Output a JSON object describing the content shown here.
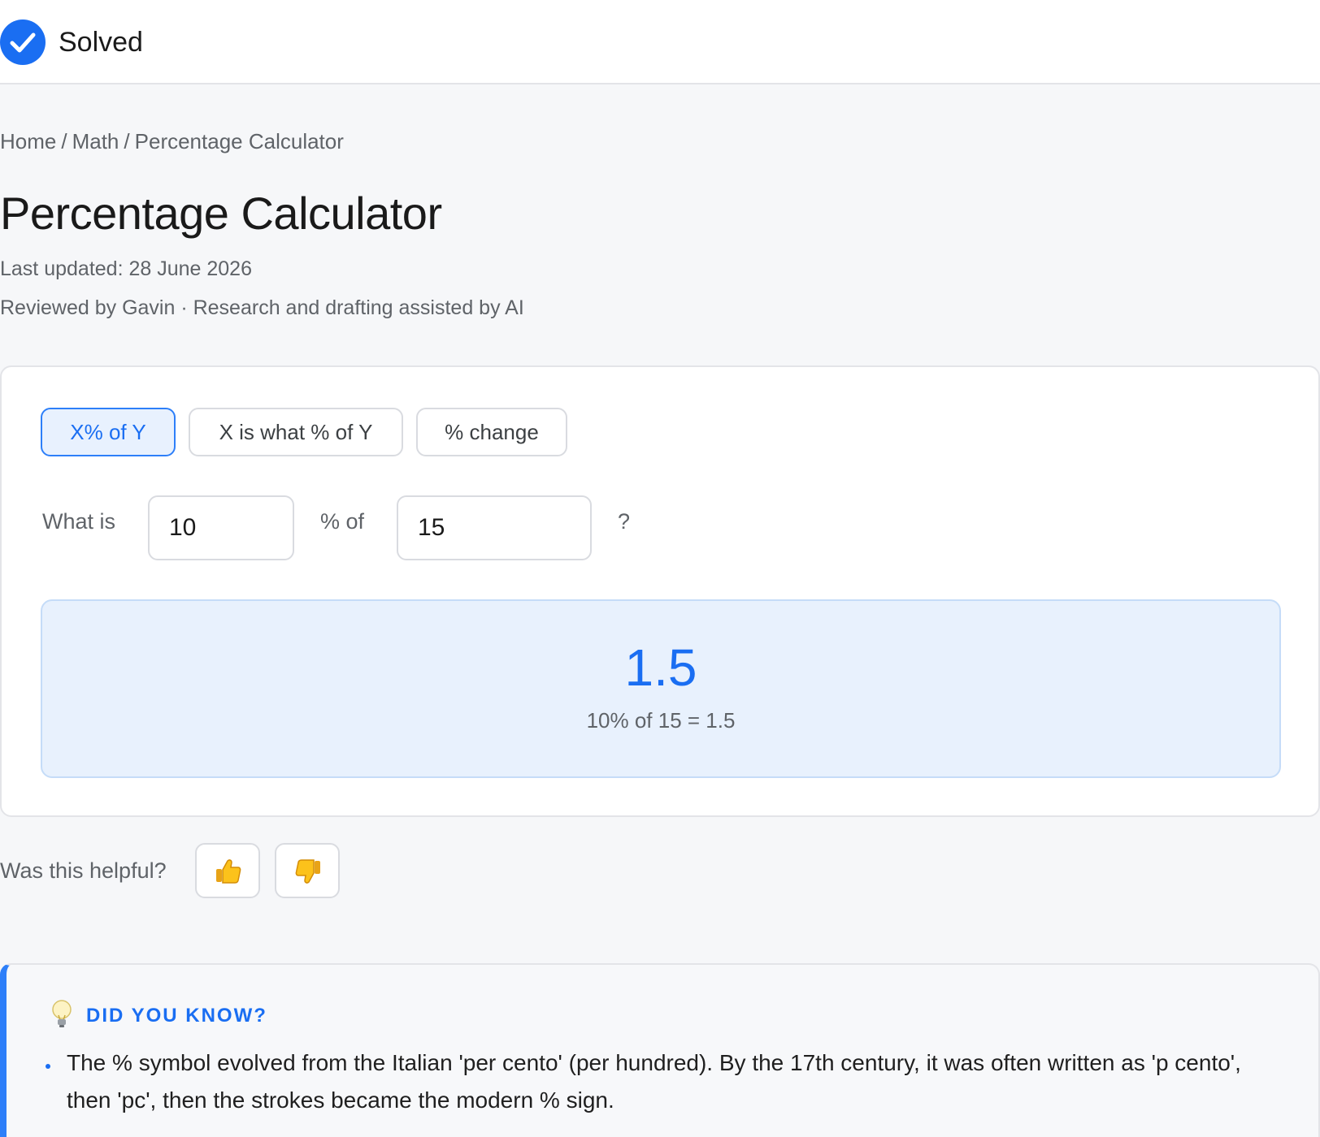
{
  "header": {
    "status_label": "Solved",
    "status_icon": "check-circle-icon",
    "accent_color": "#1a6ef2"
  },
  "breadcrumb": {
    "items": [
      "Home",
      "Math",
      "Percentage Calculator"
    ],
    "separator": "/"
  },
  "page": {
    "title": "Percentage Calculator",
    "last_updated": "Last updated: 28 June 2026",
    "reviewed_by": "Reviewed by Gavin · Research and drafting assisted by AI"
  },
  "calculator": {
    "tabs": [
      {
        "label": "X% of Y",
        "active": true
      },
      {
        "label": "X is what % of Y",
        "active": false
      },
      {
        "label": "% change",
        "active": false
      }
    ],
    "prompt_prefix": "What is",
    "prompt_middle": "% of",
    "prompt_suffix": "?",
    "x_value": "10",
    "y_value": "15",
    "result_value": "1.5",
    "result_formula": "10% of 15 = 1.5"
  },
  "feedback": {
    "label": "Was this helpful?",
    "up_icon": "thumbs-up-icon",
    "down_icon": "thumbs-down-icon"
  },
  "did_you_know": {
    "icon": "lightbulb-icon",
    "heading": "DID YOU KNOW?",
    "fact": "The % symbol evolved from the Italian 'per cento' (per hundred). By the 17th century, it was often written as 'p cento', then 'pc', then the strokes became the modern % sign."
  }
}
